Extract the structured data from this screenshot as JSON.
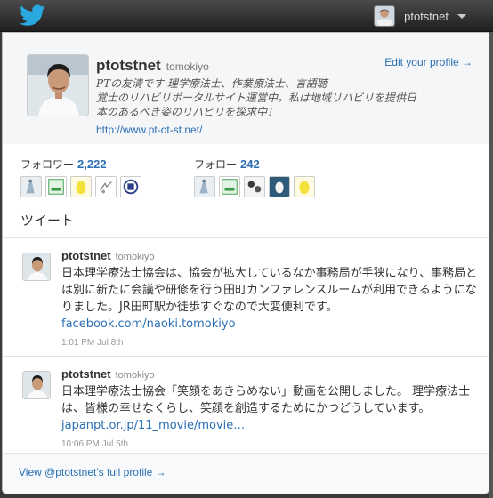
{
  "topbar": {
    "username": "ptotstnet"
  },
  "profile": {
    "name": "ptotstnet",
    "screen_name": "tomokiyo",
    "edit_label": "Edit your profile →",
    "bio_line1": "PTの友清です 理学療法士、作業療法士、言語聴",
    "bio_line2": "覚士のリハビリポータルサイト運営中。私は地域リハビリを提供日",
    "bio_line3": "本のあるべき姿のリハビリを探求中！",
    "url": "http://www.pt-ot-st.net/"
  },
  "stats": {
    "followers_label": "フォロワー",
    "followers_count": "2,222",
    "following_label": "フォロー",
    "following_count": "242"
  },
  "tweets_title": "ツイート",
  "tweets": [
    {
      "name": "ptotstnet",
      "screen_name": "tomokiyo",
      "text": "日本理学療法士協会は、協会が拡大しているなか事務局が手狭になり、事務局とは別に新たに会議や研修を行う田町カンファレンスルームが利用できるようになりました。JR田町駅か徒歩すぐなので大変便利です。",
      "link": "facebook.com/naoki.tomokiyo",
      "time": "1:01 PM Jul 8th"
    },
    {
      "name": "ptotstnet",
      "screen_name": "tomokiyo",
      "text": "日本理学療法士協会「笑顔をあきらめない」動画を公開しました。 理学療法士は、皆様の幸せなくらし、笑顔を創造するためにかつどうしています。",
      "link": "japanpt.or.jp/11_movie/movie…",
      "time": "10:06 PM Jul 5th"
    }
  ],
  "footer": {
    "label": "View @ptotstnet's full profile →"
  },
  "colors": {
    "link": "#2b6fb5",
    "twitter_blue": "#2aa9e0"
  }
}
